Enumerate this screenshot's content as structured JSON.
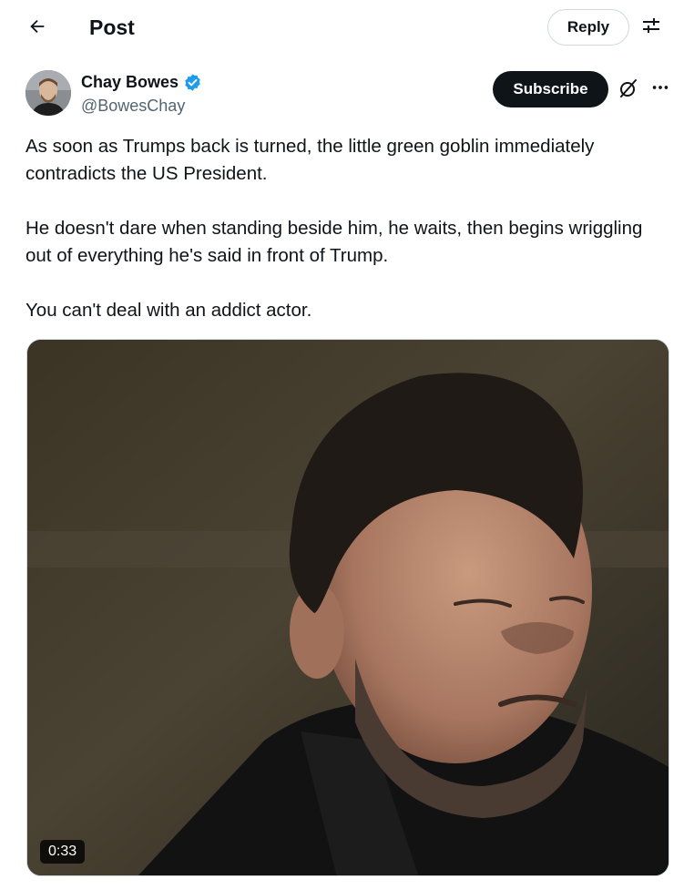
{
  "header": {
    "back_icon": "arrow-left-icon",
    "title": "Post",
    "reply_label": "Reply",
    "filter_icon": "sliders-icon"
  },
  "author": {
    "name": "Chay Bowes",
    "handle": "@BowesChay",
    "verified": true,
    "verified_color": "#1d9bf0",
    "subscribe_label": "Subscribe",
    "grok_icon": "grok-icon",
    "more_icon": "more-horizontal-icon"
  },
  "post": {
    "paragraphs": [
      "As soon as Trumps back is turned, the little green goblin immediately contradicts the US President.",
      "He doesn't dare when standing beside him, he waits, then begins wriggling out of everything he's said in front of Trump.",
      "You can't deal with an addict actor."
    ]
  },
  "media": {
    "type": "video",
    "duration": "0:33"
  },
  "colors": {
    "text": "#0f1419",
    "secondary_text": "#536471",
    "border": "#cfd9de",
    "button_dark": "#0f1419"
  }
}
